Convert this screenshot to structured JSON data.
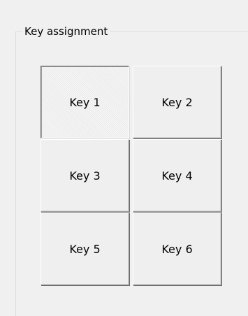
{
  "group": {
    "title": "Key assignment"
  },
  "keys": [
    {
      "label": "Key 1",
      "state": "pressed"
    },
    {
      "label": "Key 2",
      "state": "normal"
    },
    {
      "label": "Key 3",
      "state": "normal"
    },
    {
      "label": "Key 4",
      "state": "normal"
    },
    {
      "label": "Key 5",
      "state": "normal"
    },
    {
      "label": "Key 6",
      "state": "normal"
    }
  ]
}
